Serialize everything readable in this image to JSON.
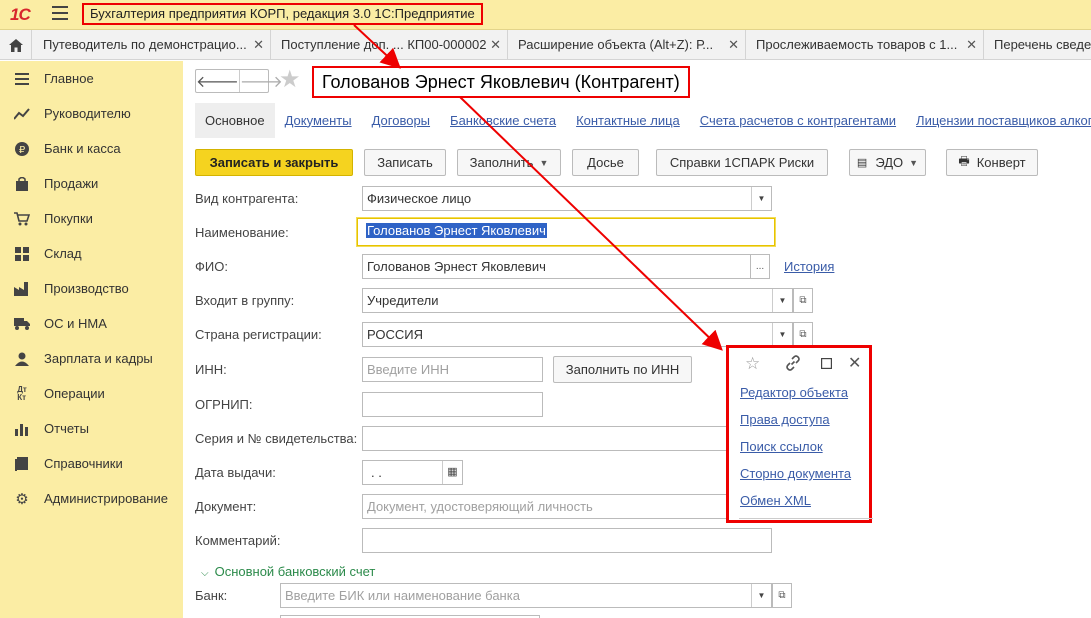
{
  "app": {
    "logo": "1С",
    "title": "Бухгалтерия предприятия КОРП, редакция 3.0 1С:Предприятие"
  },
  "tabs": [
    {
      "label": "Путеводитель по демонстрацио..."
    },
    {
      "label": "Поступление доп. ... КП00-000002"
    },
    {
      "label": "Расширение объекта (Alt+Z): Р..."
    },
    {
      "label": "Прослеживаемость товаров с 1..."
    },
    {
      "label": "Перечень сведе"
    }
  ],
  "sidebar": {
    "items": [
      {
        "label": "Главное",
        "icon": "menu-icon"
      },
      {
        "label": "Руководителю",
        "icon": "trend-icon"
      },
      {
        "label": "Банк и касса",
        "icon": "ruble-icon"
      },
      {
        "label": "Продажи",
        "icon": "bag-icon"
      },
      {
        "label": "Покупки",
        "icon": "cart-icon"
      },
      {
        "label": "Склад",
        "icon": "warehouse-icon"
      },
      {
        "label": "Производство",
        "icon": "factory-icon"
      },
      {
        "label": "ОС и НМА",
        "icon": "truck-icon"
      },
      {
        "label": "Зарплата и кадры",
        "icon": "person-icon"
      },
      {
        "label": "Операции",
        "icon": "dt-kt-icon"
      },
      {
        "label": "Отчеты",
        "icon": "bar-chart-icon"
      },
      {
        "label": "Справочники",
        "icon": "book-icon"
      },
      {
        "label": "Администрирование",
        "icon": "gear-icon"
      }
    ]
  },
  "form": {
    "title": "Голованов Эрнест Яковлевич (Контрагент)",
    "subtabs": [
      "Основное",
      "Документы",
      "Договоры",
      "Банковские счета",
      "Контактные лица",
      "Счета расчетов с контрагентами",
      "Лицензии поставщиков алкого"
    ],
    "toolbar": {
      "save_close": "Записать и закрыть",
      "save": "Записать",
      "fill": "Заполнить",
      "dossier": "Досье",
      "spark": "Справки 1СПАРК Риски",
      "edo": "ЭДО",
      "envelope": "Конверт"
    },
    "fields": {
      "kind_label": "Вид контрагента:",
      "kind_value": "Физическое лицо",
      "name_label": "Наименование:",
      "name_value": "Голованов Эрнест Яковлевич",
      "fio_label": "ФИО:",
      "fio_value": "Голованов Эрнест Яковлевич",
      "fio_button": "...",
      "history_link": "История",
      "group_label": "Входит в группу:",
      "group_value": "Учредители",
      "country_label": "Страна регистрации:",
      "country_value": "РОССИЯ",
      "inn_label": "ИНН:",
      "inn_placeholder": "Введите ИНН",
      "fill_by_inn": "Заполнить по ИНН",
      "ogrnip_label": "ОГРНИП:",
      "cert_label": "Серия и № свидетельства:",
      "issue_date_label": "Дата выдачи:",
      "issue_date_value": " .  .",
      "document_label": "Документ:",
      "document_placeholder": "Документ, удостоверяющий личность",
      "comment_label": "Комментарий:",
      "bank_section": "Основной банковский счет",
      "bank_label": "Банк:",
      "bank_placeholder": "Введите БИК или наименование банка"
    }
  },
  "popup": {
    "items": [
      "Редактор объекта",
      "Права доступа",
      "Поиск ссылок",
      "Сторно документа",
      "Обмен XML"
    ]
  },
  "colors": {
    "sidebar_bg": "#fbeda4",
    "primary_button": "#f5d31f",
    "link": "#3a5ca8",
    "annotation": "#e00000"
  }
}
